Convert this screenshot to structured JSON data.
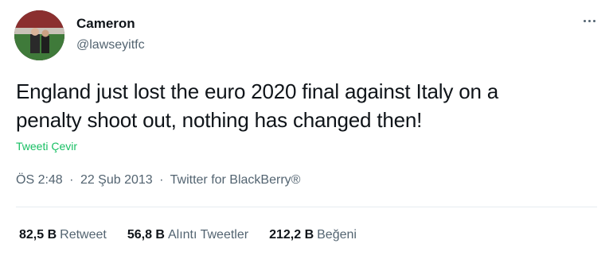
{
  "author": {
    "display_name": "Cameron",
    "handle": "@lawseyitfc"
  },
  "more_icon": "more-horizontal-icon",
  "tweet": {
    "line1": "England just lost the euro 2020 final against Italy on a",
    "line2": "penalty shoot out, nothing has changed then!",
    "translate_label": "Tweeti Çevir"
  },
  "meta": {
    "time": "ÖS 2:48",
    "separator": "·",
    "date": "22 Şub 2013",
    "source": "Twitter for BlackBerry®"
  },
  "stats": {
    "retweets": {
      "count": "82,5 B",
      "label": "Retweet"
    },
    "quotes": {
      "count": "56,8 B",
      "label": "Alıntı Tweetler"
    },
    "likes": {
      "count": "212,2 B",
      "label": "Beğeni"
    }
  },
  "colors": {
    "text": "#0f1419",
    "secondary": "#536471",
    "translate": "#17bf63",
    "divider": "#e6ecf0"
  }
}
